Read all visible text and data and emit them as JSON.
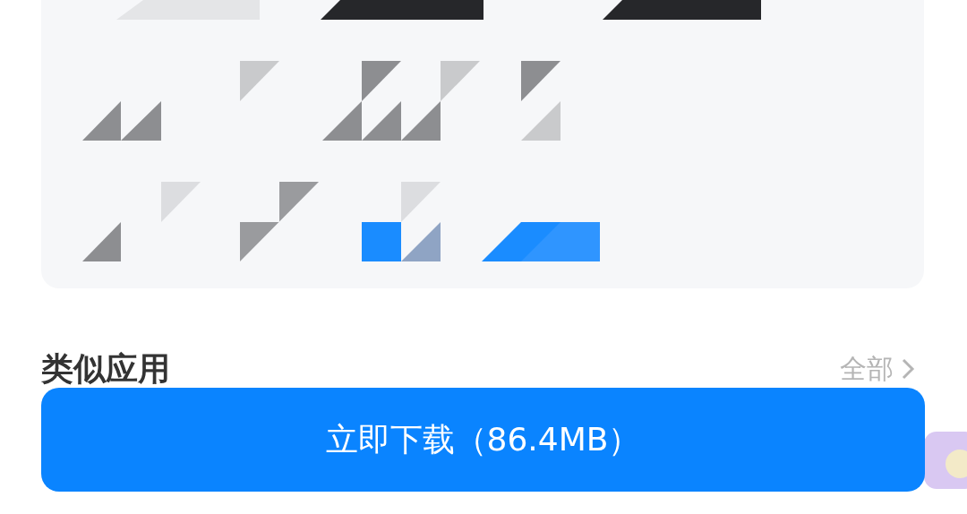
{
  "similar_apps": {
    "title": "类似应用",
    "link": "全部"
  },
  "download_button": {
    "label": "立即下载（86.4MB）"
  }
}
